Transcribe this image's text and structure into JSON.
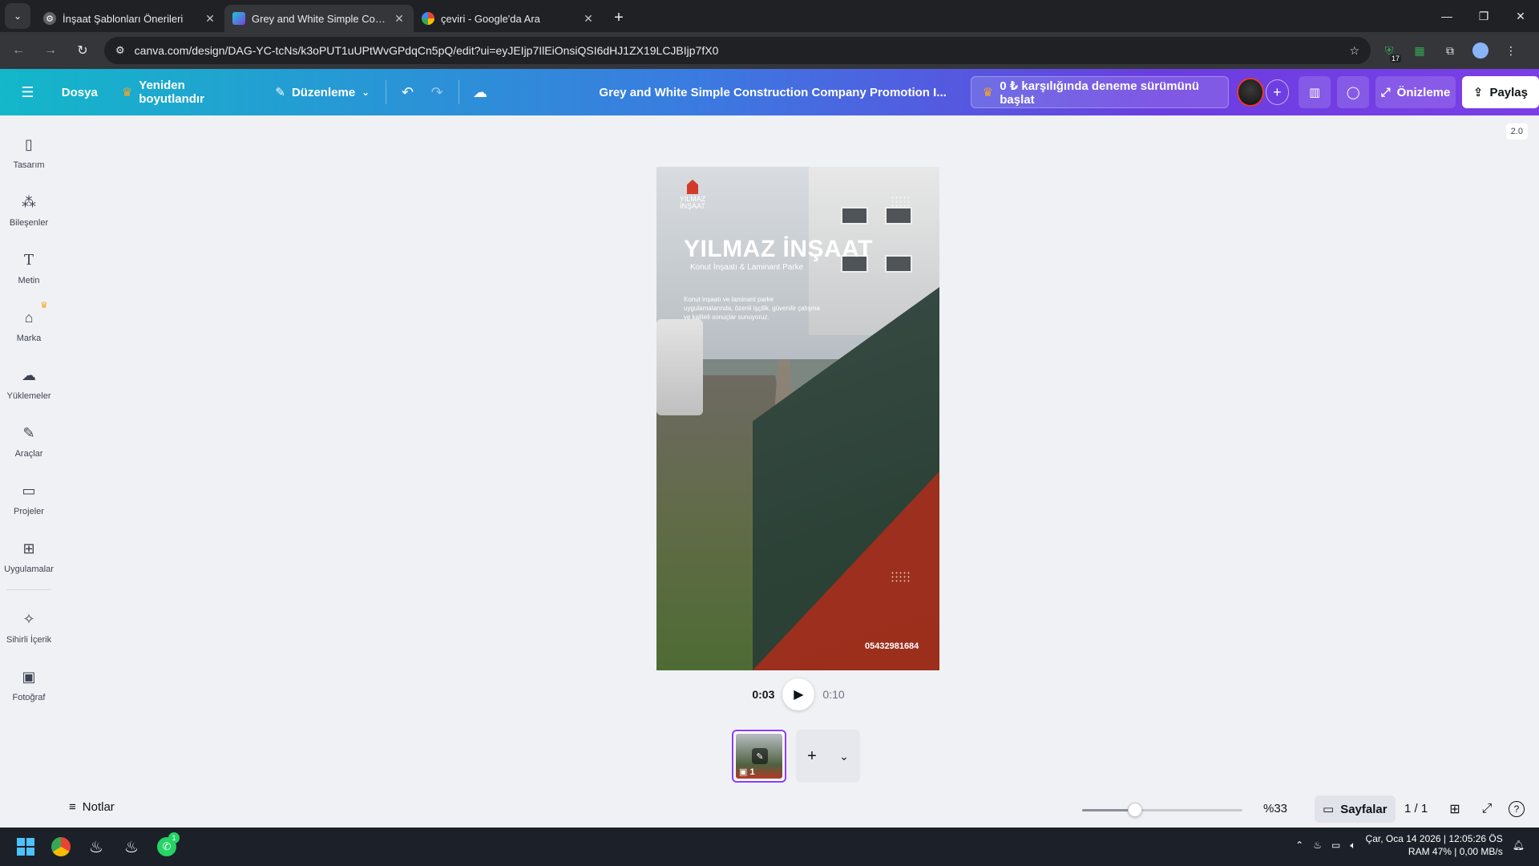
{
  "browser": {
    "tabs": [
      {
        "title": "İnşaat Şablonları Önerileri",
        "icon": "canva-settings-icon",
        "active": false
      },
      {
        "title": "Grey and White Simple Constru",
        "icon": "canva-play-icon",
        "active": true
      },
      {
        "title": "çeviri - Google'da Ara",
        "icon": "google-icon",
        "active": false
      }
    ],
    "url": "canva.com/design/DAG-YC-tcNs/k3oPUT1uUPtWvGPdqCn5pQ/edit?ui=eyJEIjp7IlEiOnsiQSI6dHJ1ZX19LCJBIjp7fX0",
    "extension_badge": "17"
  },
  "header": {
    "file_label": "Dosya",
    "resize_label": "Yeniden boyutlandır",
    "edit_label": "Düzenleme",
    "doc_title": "Grey and White Simple Construction Company Promotion I...",
    "trial_label": "0 ₺ karşılığında deneme sürümünü başlat",
    "preview_label": "Önizleme",
    "share_label": "Paylaş"
  },
  "sidebar": {
    "items": [
      {
        "label": "Tasarım",
        "icon": "layout-icon"
      },
      {
        "label": "Bileşenler",
        "icon": "elements-icon"
      },
      {
        "label": "Metin",
        "icon": "text-icon"
      },
      {
        "label": "Marka",
        "icon": "brand-icon"
      },
      {
        "label": "Yüklemeler",
        "icon": "upload-cloud-icon"
      },
      {
        "label": "Araçlar",
        "icon": "draw-tool-icon"
      },
      {
        "label": "Projeler",
        "icon": "folder-icon"
      },
      {
        "label": "Uygulamalar",
        "icon": "apps-icon"
      },
      {
        "label": "Sihirli İçerik",
        "icon": "magic-media-icon"
      },
      {
        "label": "Fotoğraf",
        "icon": "photo-icon"
      }
    ]
  },
  "canvas": {
    "version_tag": "2.0",
    "logo_text": "YILMAZ İNŞAAT",
    "headline": "YILMAZ İNŞAAT",
    "subheadline": "Konut İnşaatı & Laminant Parke",
    "description": "Konut inşaatı ve laminant parke uygulamalarında, özenli işçilik, güvenilir çalışma ve kaliteli sonuçlar sunuyoruz.",
    "phone": "05432981684"
  },
  "playback": {
    "current": "0:03",
    "total": "0:10"
  },
  "pages": {
    "thumb_number": "1"
  },
  "bottom": {
    "notes_label": "Notlar",
    "zoom_fraction": 0.33,
    "zoom_label": "%33",
    "pages_label": "Sayfalar",
    "page_count": "1 / 1"
  },
  "taskbar": {
    "clock_line1": "Çar, Oca 14 2026 | 12:05:26 ÖS",
    "clock_line2": "RAM 47% |",
    "net_label": "0,00 MB/s",
    "whatsapp_badge": "1"
  },
  "colors": {
    "accent": "#8b3dff",
    "header_gradient_start": "#13b7c9",
    "header_gradient_end": "#7a3fe6"
  }
}
